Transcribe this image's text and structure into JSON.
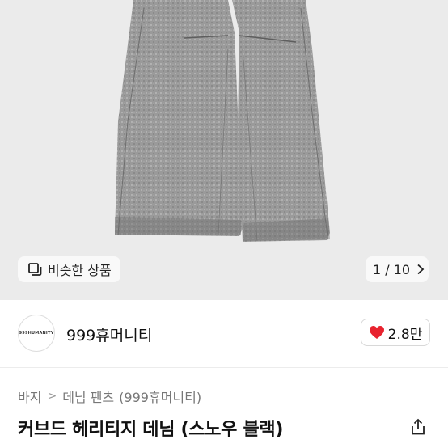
{
  "gallery": {
    "similar_label": "비슷한 상품",
    "counter": "1 / 10",
    "similar_icon": "copy-icon",
    "next_icon": "chevron-right-icon"
  },
  "shop": {
    "logo_text": "999HUMANITY",
    "name": "999휴머니티",
    "likes": "2.8만",
    "heart_color": "#e8232f"
  },
  "breadcrumb": {
    "level1": "바지",
    "level2": "데님 팬츠",
    "brand": "(999휴머니티)"
  },
  "product": {
    "title": "커브드 헤리티지 데님 (스노우 블랙)"
  }
}
